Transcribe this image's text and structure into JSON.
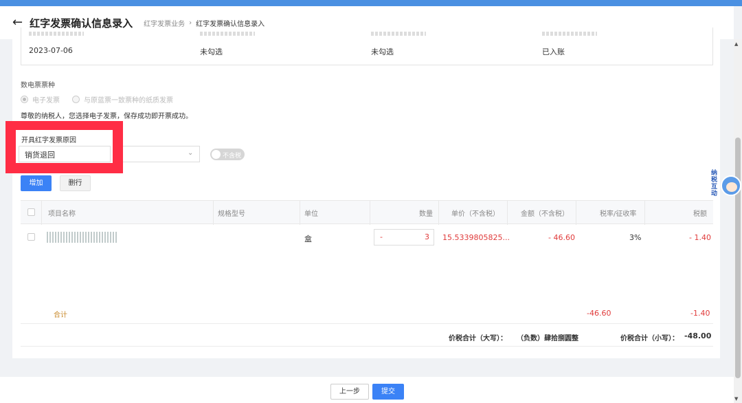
{
  "header": {
    "title": "红字发票确认信息录入",
    "breadcrumb": [
      "红字发票业务",
      "红字发票确认信息录入"
    ],
    "back_icon": "arrow-left-icon"
  },
  "info": {
    "values": [
      "2023-07-06",
      "未勾选",
      "未勾选",
      "已入账"
    ]
  },
  "invoice_type": {
    "label": "数电票票种",
    "option1": "电子发票",
    "option2": "与原蓝票一致票种的纸质发票",
    "notice": "尊敬的纳税人，您选择电子发票，保存成功即开票成功。"
  },
  "reason": {
    "label": "开具红字发票原因",
    "value": "销货退回",
    "toggle_label": "不含税"
  },
  "toolbar": {
    "add_label": "增加",
    "delete_label": "删行"
  },
  "table": {
    "headers": [
      "项目名称",
      "规格型号",
      "单位",
      "数量",
      "单价（不含税）",
      "金额（不含税）",
      "税率/征收率",
      "税额"
    ],
    "row": {
      "unit": "盒",
      "qty_minus": "-",
      "qty": "3",
      "price": "15.5339805825...",
      "amount": "- 46.60",
      "rate": "3%",
      "tax": "- 1.40"
    },
    "sum_label": "合计",
    "sum_amount": "-46.60",
    "sum_tax": "-1.40",
    "total_upper_label": "价税合计（大写）：",
    "total_upper_value": "（负数）肆拾捌圆整",
    "total_lower_label": "价税合计（小写）：",
    "total_lower_value": "-48.00"
  },
  "footer": {
    "prev_label": "上一步",
    "submit_label": "提交"
  },
  "mascot": {
    "text": "纳 税 互 动"
  },
  "colors": {
    "primary": "#3b82f6",
    "highlight": "#ff2d45",
    "negative": "#e03a3a"
  }
}
